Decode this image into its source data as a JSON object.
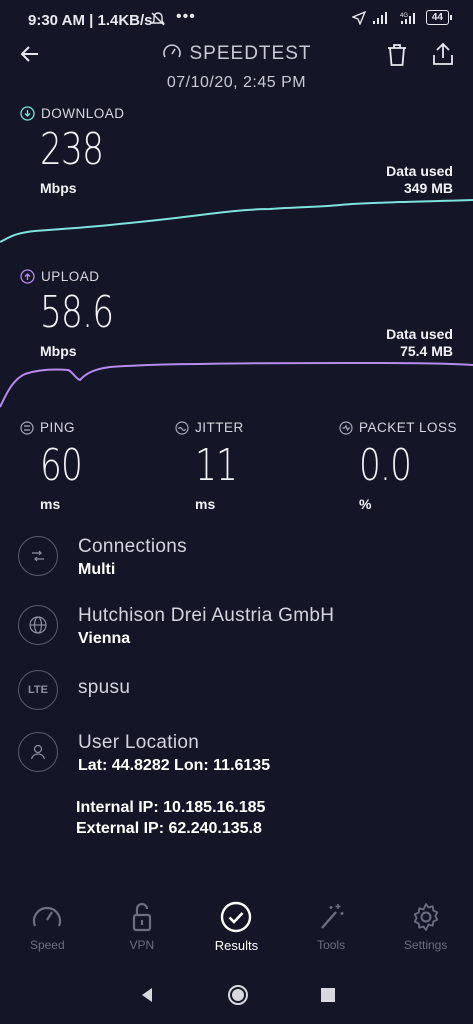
{
  "status_bar": {
    "time": "9:30 AM | 1.4KB/s",
    "battery": "44"
  },
  "header": {
    "title": "SPEEDTEST",
    "date": "07/10/20, 2:45 PM"
  },
  "download": {
    "label": "DOWNLOAD",
    "value": "238",
    "unit": "Mbps",
    "data_used_label": "Data used",
    "data_used_value": "349 MB",
    "color": "#7ee3dd"
  },
  "upload": {
    "label": "UPLOAD",
    "value": "58.6",
    "unit": "Mbps",
    "data_used_label": "Data used",
    "data_used_value": "75.4 MB",
    "color": "#b78af0"
  },
  "ping": {
    "label": "PING",
    "value": "60",
    "unit": "ms"
  },
  "jitter": {
    "label": "JITTER",
    "value": "11",
    "unit": "ms"
  },
  "packet_loss": {
    "label": "PACKET LOSS",
    "value": "0.0",
    "unit": "%"
  },
  "connections": {
    "title": "Connections",
    "value": "Multi"
  },
  "provider": {
    "title": "Hutchison Drei Austria GmbH",
    "value": "Vienna"
  },
  "carrier": {
    "badge": "LTE",
    "title": "spusu"
  },
  "location": {
    "title": "User Location",
    "value": "Lat: 44.8282 Lon: 11.6135"
  },
  "ips": {
    "internal": "Internal IP: 10.185.16.185",
    "external": "External IP: 62.240.135.8"
  },
  "nav": {
    "speed": "Speed",
    "vpn": "VPN",
    "results": "Results",
    "tools": "Tools",
    "settings": "Settings"
  }
}
